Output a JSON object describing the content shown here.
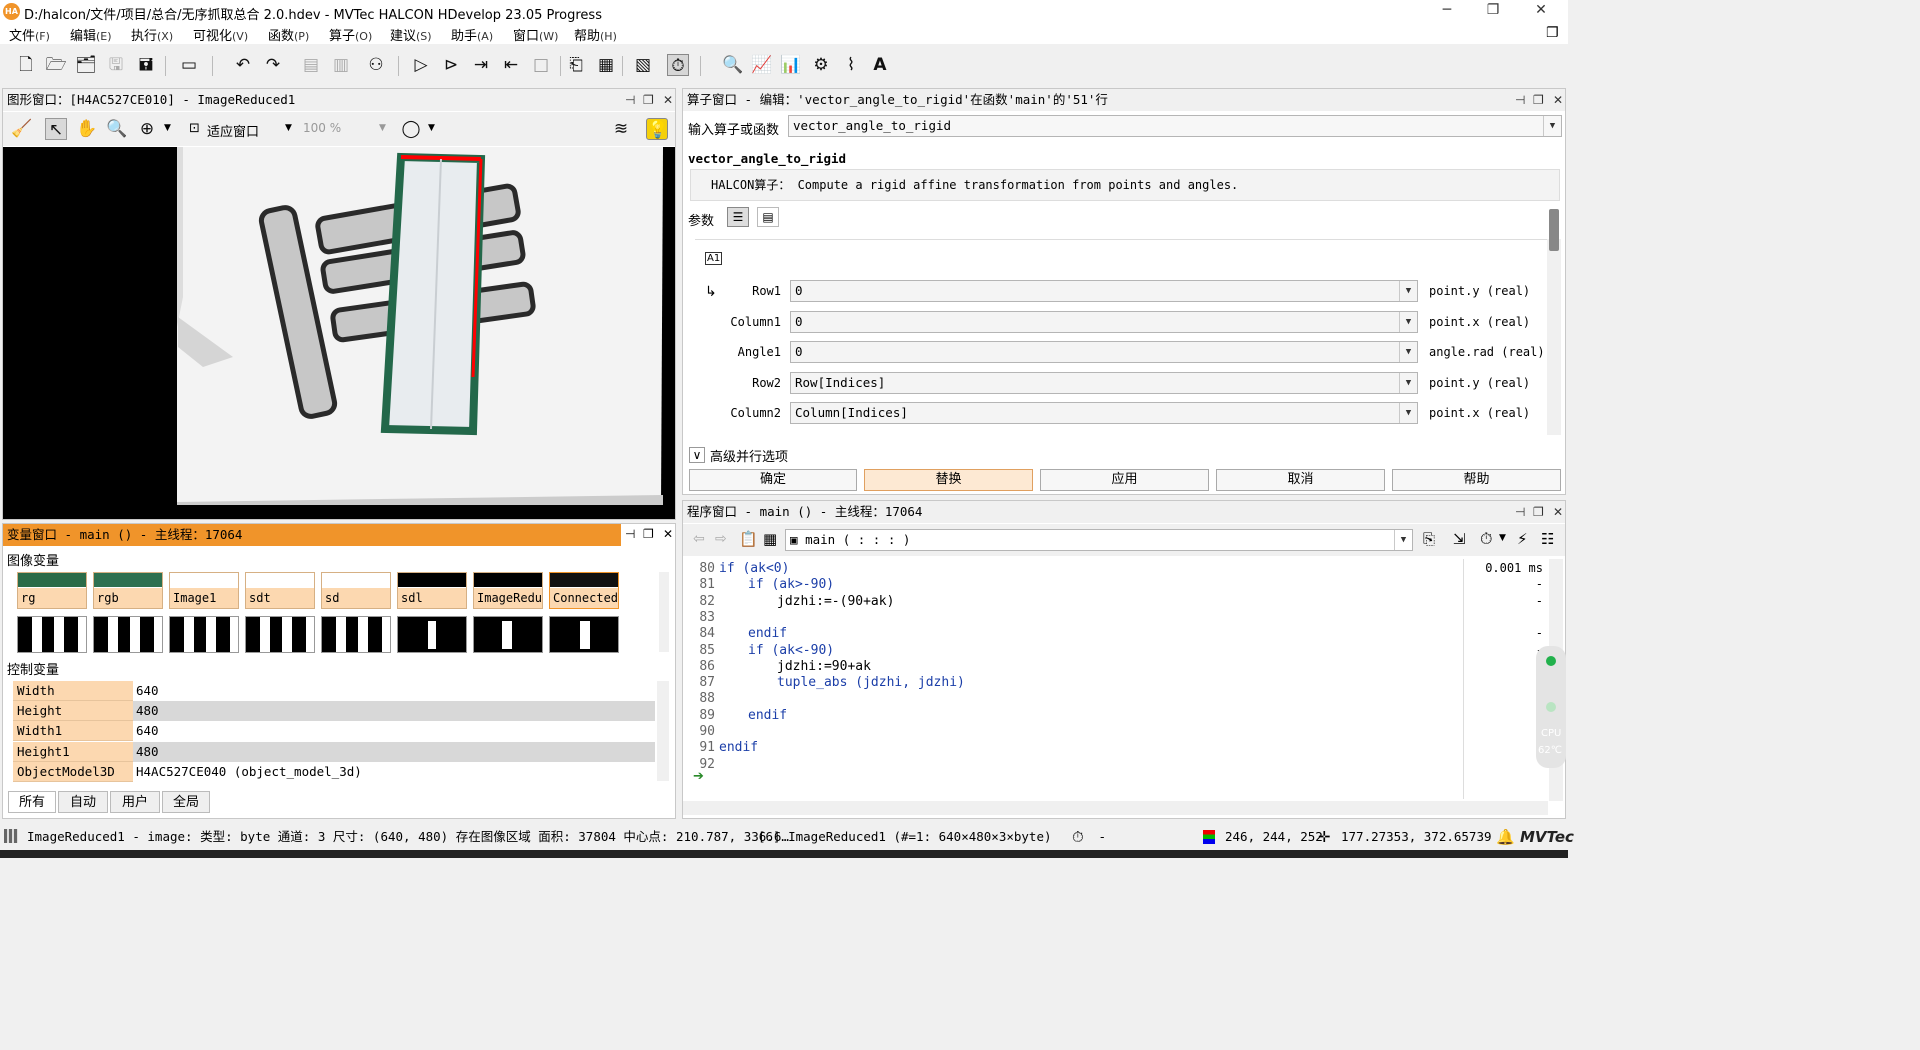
{
  "title": "D:/halcon/文件/项目/总合/无序抓取总合 2.0.hdev - MVTec HALCON HDevelop 23.05 Progress",
  "app_icon": "HA",
  "menu": [
    {
      "label": "文件",
      "key": "(F)"
    },
    {
      "label": "编辑",
      "key": "(E)"
    },
    {
      "label": "执行",
      "key": "(X)"
    },
    {
      "label": "可视化",
      "key": "(V)"
    },
    {
      "label": "函数",
      "key": "(P)"
    },
    {
      "label": "算子",
      "key": "(O)"
    },
    {
      "label": "建议",
      "key": "(S)"
    },
    {
      "label": "助手",
      "key": "(A)"
    },
    {
      "label": "窗口",
      "key": "(W)"
    },
    {
      "label": "帮助",
      "key": "(H)"
    }
  ],
  "graphics": {
    "header": "图形窗口：[H4AC527CE010] - ImageReduced1",
    "fit_label": "适应窗口",
    "zoom_label": "100 %"
  },
  "operator": {
    "header": "算子窗口 - 编辑：'vector_angle_to_rigid'在函数'main'的'51'行",
    "input_label": "输入算子或函数",
    "input_value": "vector_angle_to_rigid",
    "name": "vector_angle_to_rigid",
    "desc": "HALCON算子： Compute a rigid affine transformation from points and angles.",
    "params_label": "参数",
    "params": [
      {
        "name": "Row1",
        "value": "0",
        "type": "point.y (real)"
      },
      {
        "name": "Column1",
        "value": "0",
        "type": "point.x (real)"
      },
      {
        "name": "Angle1",
        "value": "0",
        "type": "angle.rad (real)"
      },
      {
        "name": "Row2",
        "value": "Row[Indices]",
        "type": "point.y (real)"
      },
      {
        "name": "Column2",
        "value": "Column[Indices]",
        "type": "point.x (real)"
      }
    ],
    "advanced": "高级并行选项",
    "buttons": [
      "确定",
      "替换",
      "应用",
      "取消",
      "帮助"
    ]
  },
  "variables": {
    "header": "变量窗口 - main () - 主线程：17064",
    "image_vars_label": "图像变量",
    "image_vars": [
      "rg",
      "rgb",
      "Image1",
      "sdt",
      "sd",
      "sdl",
      "ImageReduc",
      "ConnectedR"
    ],
    "control_vars_label": "控制变量",
    "control_vars": [
      {
        "name": "Width",
        "value": "640"
      },
      {
        "name": "Height",
        "value": "480"
      },
      {
        "name": "Width1",
        "value": "640"
      },
      {
        "name": "Height1",
        "value": "480"
      },
      {
        "name": "ObjectModel3D",
        "value": "H4AC527CE040 (object_model_3d)"
      }
    ],
    "tabs": [
      "所有",
      "自动",
      "用户",
      "全局"
    ]
  },
  "program": {
    "header": "程序窗口 - main () - 主线程：17064",
    "proc_select": "main ( : : : )",
    "lines": [
      {
        "n": "80",
        "indent": 0,
        "parts": [
          {
            "t": "if (ak<0)",
            "c": "kw"
          }
        ]
      },
      {
        "n": "81",
        "indent": 1,
        "parts": [
          {
            "t": "if (ak>-90)",
            "c": "kw"
          }
        ]
      },
      {
        "n": "82",
        "indent": 2,
        "parts": [
          {
            "t": "jdzhi:=-(90+ak)",
            "c": ""
          }
        ]
      },
      {
        "n": "83",
        "indent": 0,
        "parts": []
      },
      {
        "n": "84",
        "indent": 1,
        "parts": [
          {
            "t": "endif",
            "c": "kw"
          }
        ]
      },
      {
        "n": "85",
        "indent": 1,
        "parts": [
          {
            "t": "if (ak<-90)",
            "c": "kw"
          }
        ]
      },
      {
        "n": "86",
        "indent": 2,
        "parts": [
          {
            "t": "jdzhi:=90+ak",
            "c": ""
          }
        ]
      },
      {
        "n": "87",
        "indent": 2,
        "parts": [
          {
            "t": "tuple_abs",
            "c": "fn"
          },
          {
            "t": " (jdzhi, jdzhi)",
            "c": "kw"
          }
        ]
      },
      {
        "n": "88",
        "indent": 0,
        "parts": []
      },
      {
        "n": "89",
        "indent": 1,
        "parts": [
          {
            "t": "endif",
            "c": "kw"
          }
        ]
      },
      {
        "n": "90",
        "indent": 0,
        "parts": []
      },
      {
        "n": "91",
        "indent": 0,
        "parts": [
          {
            "t": "endif",
            "c": "kw"
          }
        ]
      },
      {
        "n": "92",
        "indent": 0,
        "parts": []
      }
    ],
    "timing_first": "0.001 ms",
    "timing_dash": "-",
    "cpu_label": "CPU",
    "cpu_temp": "62℃"
  },
  "status": {
    "info": "ImageReduced1 - image: 类型: byte 通道: 3 尺寸: (640, 480) 存在图像区域 面积: 37804 中心点: 210.787, 336.6…",
    "image_info": "[6] ImageReduced1 (#=1: 640×480×3×byte)",
    "dash": "-",
    "rgb": "246, 244, 252",
    "coords": "177.27353, 372.65739",
    "logo": "MVTec"
  },
  "colors": {
    "accent": "#f0942a",
    "var_label": "#fcd8b0",
    "selected_btn": "#fde9d3"
  }
}
